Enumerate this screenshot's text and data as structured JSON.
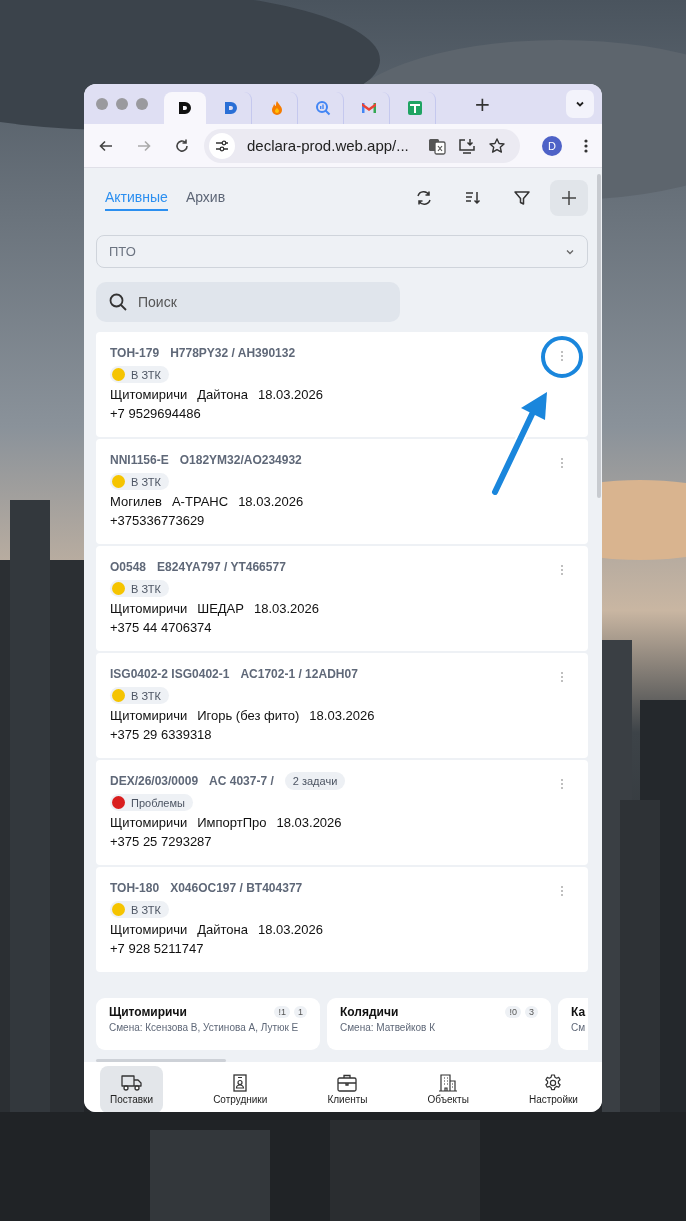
{
  "browser": {
    "tabs": [
      {
        "kind": "logo-dark",
        "selected": true
      },
      {
        "kind": "logo-blue",
        "selected": false
      },
      {
        "kind": "flame",
        "selected": false
      },
      {
        "kind": "analytics",
        "selected": false
      },
      {
        "kind": "mail",
        "selected": false
      },
      {
        "kind": "sheet",
        "selected": false
      }
    ],
    "new_tab": "+",
    "address": "declara-prod.web.app/...",
    "profile": "D"
  },
  "view_tabs": [
    {
      "label": "Активные",
      "selected": true
    },
    {
      "label": "Архив",
      "selected": false
    }
  ],
  "select": {
    "value": "ПТО"
  },
  "search": {
    "placeholder": "Поиск"
  },
  "shipments": [
    {
      "code": "TOH-179",
      "plates": "H778PY32 / AH390132",
      "status": {
        "label": "В ЗТК",
        "color": "#f5c400"
      },
      "city": "Щитомиричи",
      "company": "Дайтона",
      "date": "18.03.2026",
      "phone": "+7 9529694486"
    },
    {
      "code": "NNI1156-E",
      "plates": "O182YM32/AO234932",
      "status": {
        "label": "В ЗТК",
        "color": "#f5c400"
      },
      "city": "Могилев",
      "company": "А-ТРАНС",
      "date": "18.03.2026",
      "phone": "+375336773629"
    },
    {
      "code": "O0548",
      "plates": "E824YA797 / YT466577",
      "status": {
        "label": "В ЗТК",
        "color": "#f5c400"
      },
      "city": "Щитомиричи",
      "company": "ШЕДАР",
      "date": "18.03.2026",
      "phone": "+375 44 4706374"
    },
    {
      "code": "ISG0402-2 ISG0402-1",
      "plates": "AC1702-1 / 12ADH07",
      "status": {
        "label": "В ЗТК",
        "color": "#f5c400"
      },
      "city": "Щитомиричи",
      "company": "Игорь (без фито)",
      "date": "18.03.2026",
      "phone": "+375 29 6339318"
    },
    {
      "code": "DEX/26/03/0009",
      "plates": "AC 4037-7 /",
      "tasks": "2 задачи",
      "status": {
        "label": "Проблемы",
        "color": "#d91e1e"
      },
      "city": "Щитомиричи",
      "company": "ИмпортПро",
      "date": "18.03.2026",
      "phone": "+375 25 7293287"
    },
    {
      "code": "TOH-180",
      "plates": "X046OC197 / BT404377",
      "status": {
        "label": "В ЗТК",
        "color": "#f5c400"
      },
      "city": "Щитомиричи",
      "company": "Дайтона",
      "date": "18.03.2026",
      "phone": "+7 928 5211747"
    }
  ],
  "shifts": [
    {
      "name": "Щитомиричи",
      "alerts": "!1",
      "count": "1",
      "staff": "Смена: Ксензова В, Устинова А, Лутюк Е"
    },
    {
      "name": "Колядичи",
      "alerts": "!0",
      "count": "3",
      "staff": "Смена: Матвейков К"
    },
    {
      "name": "Ка",
      "staff": "См"
    }
  ],
  "nav": [
    {
      "label": "Поставки",
      "kind": "truck",
      "selected": true
    },
    {
      "label": "Сотрудники",
      "kind": "badge",
      "selected": false
    },
    {
      "label": "Клиенты",
      "kind": "briefcase",
      "selected": false
    },
    {
      "label": "Объекты",
      "kind": "building",
      "selected": false
    },
    {
      "label": "Настройки",
      "kind": "gear",
      "selected": false
    }
  ]
}
